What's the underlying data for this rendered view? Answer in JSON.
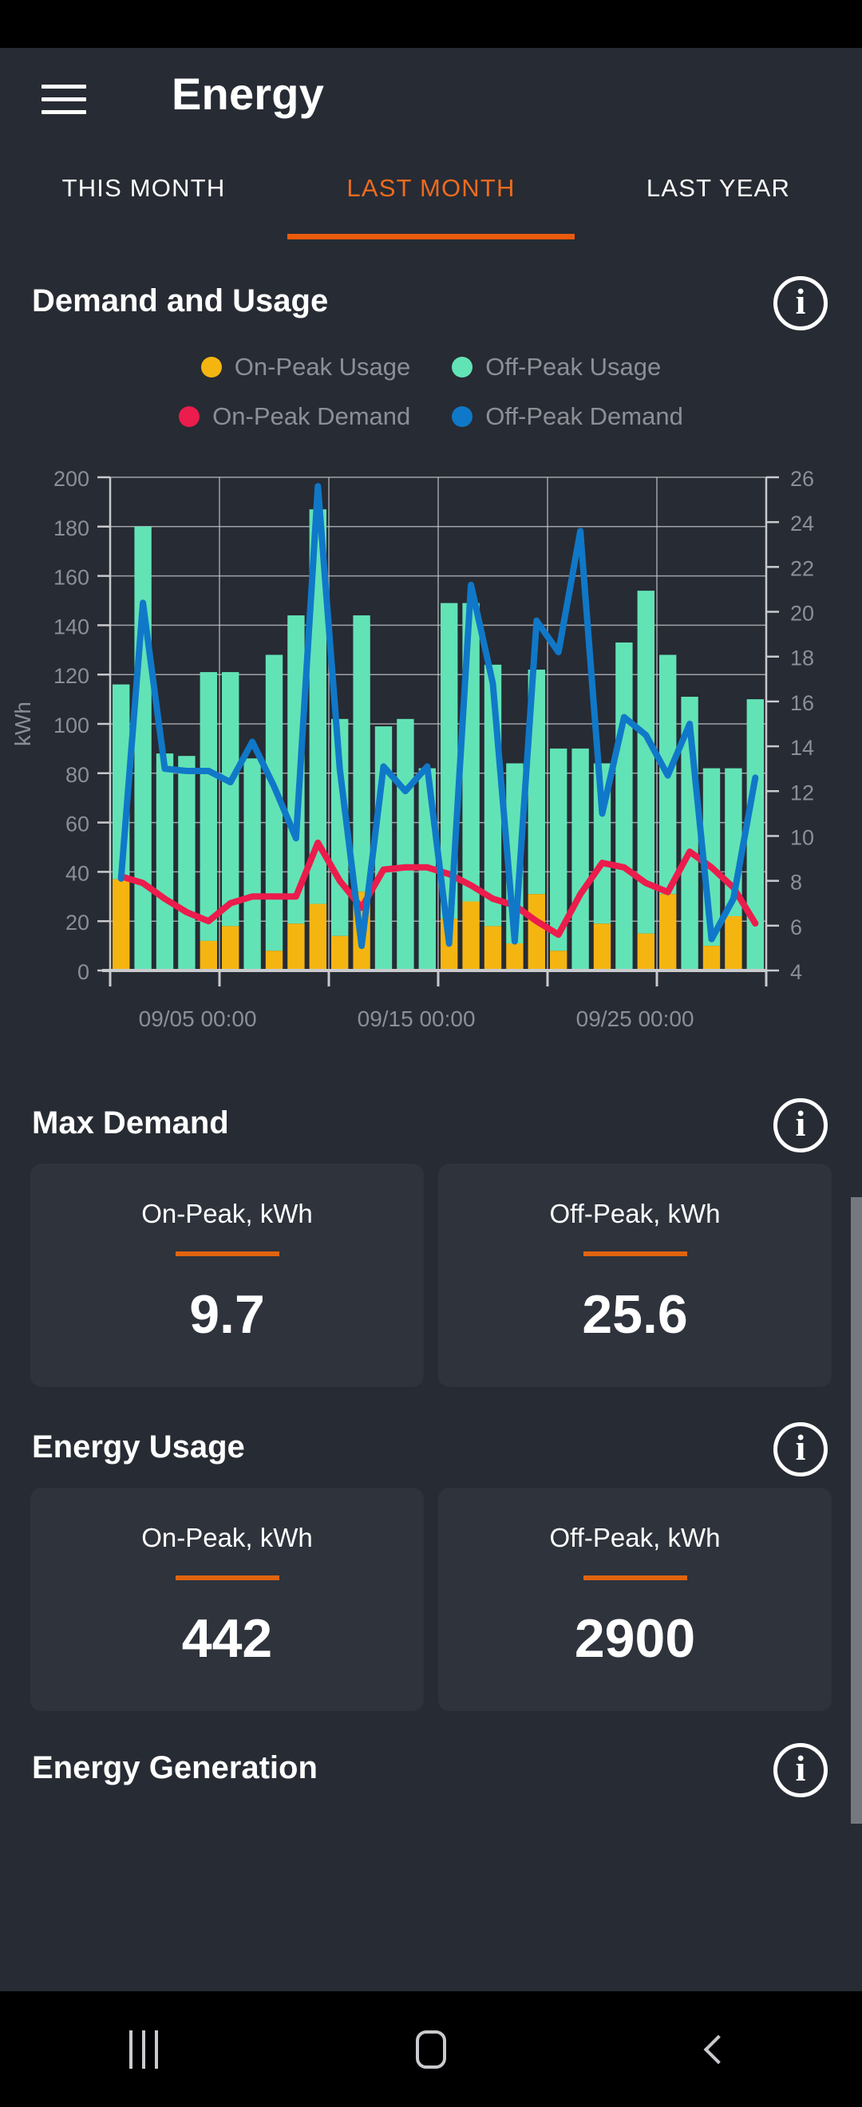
{
  "app": {
    "title": "Energy",
    "menu_icon": "hamburger-menu-icon"
  },
  "tabs": [
    {
      "label": "THIS MONTH",
      "active": false
    },
    {
      "label": "LAST MONTH",
      "active": true
    },
    {
      "label": "LAST YEAR",
      "active": false
    }
  ],
  "sections": {
    "demand_and_usage": {
      "title": "Demand and Usage",
      "info_icon": "info-icon"
    },
    "max_demand": {
      "title": "Max Demand",
      "info_icon": "info-icon"
    },
    "energy_usage": {
      "title": "Energy Usage",
      "info_icon": "info-icon"
    },
    "energy_generation": {
      "title": "Energy Generation",
      "info_icon": "info-icon"
    }
  },
  "legend": [
    {
      "label": "On-Peak Usage",
      "color": "#f5b511"
    },
    {
      "label": "Off-Peak Usage",
      "color": "#62e3b6"
    },
    {
      "label": "On-Peak Demand",
      "color": "#ec1c4d"
    },
    {
      "label": "Off-Peak Demand",
      "color": "#1078c8"
    }
  ],
  "max_demand_cards": [
    {
      "label": "On-Peak, kWh",
      "value": "9.7"
    },
    {
      "label": "Off-Peak, kWh",
      "value": "25.6"
    }
  ],
  "energy_usage_cards": [
    {
      "label": "On-Peak, kWh",
      "value": "442"
    },
    {
      "label": "Off-Peak, kWh",
      "value": "2900"
    }
  ],
  "navbar": [
    {
      "name": "recents-button",
      "icon": "recents-icon"
    },
    {
      "name": "home-button",
      "icon": "home-icon"
    },
    {
      "name": "back-button",
      "icon": "back-chevron-icon"
    }
  ],
  "colors": {
    "accent": "#ea5b0c",
    "background": "#272b33",
    "card": "#2e333c",
    "on_peak_usage": "#f5b511",
    "off_peak_usage": "#62e3b6",
    "on_peak_demand": "#ec1c4d",
    "off_peak_demand": "#1078c8",
    "axis_text": "#8c8f96",
    "grid": "#c9cace"
  },
  "chart_data": {
    "type": "bar",
    "title": "Demand and Usage",
    "xlabel": "",
    "ylabel": "kWh",
    "y2label": "",
    "ylim": [
      0,
      200
    ],
    "y2lim": [
      4,
      26
    ],
    "yticks": [
      0,
      20,
      40,
      60,
      80,
      100,
      120,
      140,
      160,
      180,
      200
    ],
    "y2ticks": [
      4,
      6,
      8,
      10,
      12,
      14,
      16,
      18,
      20,
      22,
      24,
      26
    ],
    "grid": true,
    "legend_position": "top",
    "xtick_labels": [
      "09/05 00:00",
      "09/15 00:00",
      "09/25 00:00"
    ],
    "xtick_indices": [
      4,
      14,
      24
    ],
    "categories": [
      "09/01",
      "09/02",
      "09/03",
      "09/04",
      "09/05",
      "09/06",
      "09/07",
      "09/08",
      "09/09",
      "09/10",
      "09/11",
      "09/12",
      "09/13",
      "09/14",
      "09/15",
      "09/16",
      "09/17",
      "09/18",
      "09/19",
      "09/20",
      "09/21",
      "09/22",
      "09/23",
      "09/24",
      "09/25",
      "09/26",
      "09/27",
      "09/28",
      "09/29",
      "09/30"
    ],
    "series": [
      {
        "name": "On-Peak Usage",
        "type": "bar-stacked",
        "axis": "left",
        "color": "#f5b511",
        "values": [
          37,
          0,
          0,
          0,
          12,
          18,
          0,
          8,
          19,
          27,
          14,
          32,
          0,
          0,
          0,
          21,
          28,
          18,
          11,
          31,
          8,
          0,
          19,
          0,
          15,
          31,
          0,
          10,
          22,
          0
        ]
      },
      {
        "name": "Off-Peak Usage",
        "type": "bar-stacked",
        "axis": "left",
        "color": "#62e3b6",
        "values": [
          79,
          180,
          88,
          87,
          109,
          103,
          86,
          120,
          125,
          160,
          88,
          112,
          99,
          102,
          82,
          128,
          121,
          106,
          73,
          91,
          82,
          90,
          65,
          133,
          139,
          97,
          111,
          72,
          60,
          110
        ]
      },
      {
        "name": "On-Peak Demand",
        "type": "line",
        "axis": "right",
        "color": "#ec1c4d",
        "values": [
          8.2,
          7.9,
          7.2,
          6.6,
          6.2,
          7.0,
          7.3,
          7.3,
          7.3,
          9.7,
          8.0,
          6.8,
          8.5,
          8.6,
          8.6,
          8.3,
          7.8,
          7.2,
          6.9,
          6.2,
          5.6,
          7.4,
          8.8,
          8.6,
          7.9,
          7.5,
          9.3,
          8.6,
          7.7,
          6.1
        ]
      },
      {
        "name": "Off-Peak Demand",
        "type": "line",
        "axis": "right",
        "color": "#1078c8",
        "values": [
          8.1,
          20.4,
          13.0,
          12.9,
          12.9,
          12.4,
          14.2,
          12.2,
          9.9,
          25.6,
          13.0,
          5.1,
          13.1,
          12.0,
          13.1,
          5.2,
          21.2,
          16.8,
          5.3,
          19.6,
          18.2,
          23.6,
          11.0,
          15.3,
          14.5,
          12.7,
          15.0,
          5.4,
          7.2,
          12.6
        ]
      }
    ]
  }
}
